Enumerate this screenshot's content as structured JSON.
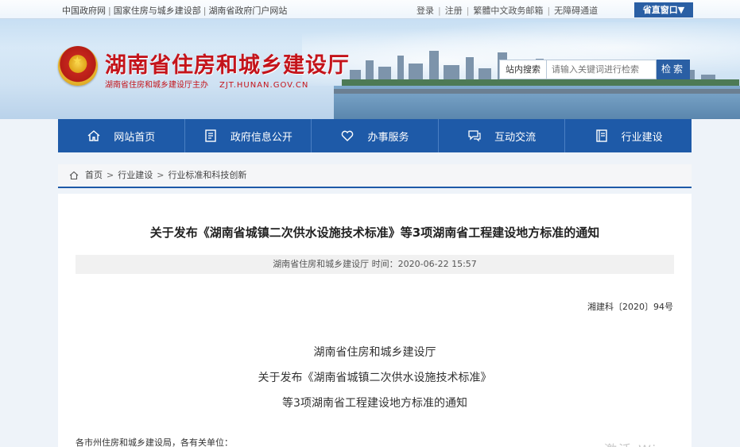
{
  "topbar": {
    "links": [
      "中国政府网",
      "国家住房与城乡建设部",
      "湖南省政府门户网站"
    ],
    "user_links": [
      "登录",
      "注册",
      "繁體中文",
      "政务邮箱",
      "无障碍通道"
    ],
    "window_button": "省直窗口▼"
  },
  "header": {
    "title": "湖南省住房和城乡建设厅",
    "sponsor": "湖南省住房和城乡建设厅主办",
    "domain": "ZJT.HUNAN.GOV.CN"
  },
  "search": {
    "label": "站内搜索",
    "placeholder": "请输入关键词进行检索",
    "button": "检索"
  },
  "nav": [
    {
      "label": "网站首页",
      "icon": "home-icon"
    },
    {
      "label": "政府信息公开",
      "icon": "document-icon"
    },
    {
      "label": "办事服务",
      "icon": "heart-icon"
    },
    {
      "label": "互动交流",
      "icon": "chat-icon"
    },
    {
      "label": "行业建设",
      "icon": "book-icon"
    }
  ],
  "breadcrumb": {
    "home": "首页",
    "level1": "行业建设",
    "level2": "行业标准和科技创新"
  },
  "article": {
    "title": "关于发布《湖南省城镇二次供水设施技术标准》等3项湖南省工程建设地方标准的通知",
    "meta": "湖南省住房和城乡建设厅 时间：2020-06-22 15:57",
    "doc_number": "湘建科〔2020〕94号",
    "issuer": "湖南省住房和城乡建设厅",
    "heading_line1": "关于发布《湖南省城镇二次供水设施技术标准》",
    "heading_line2": "等3项湖南省工程建设地方标准的通知",
    "salutation": "各市州住房和城乡建设局，各有关单位："
  },
  "watermark": "激活 Wi"
}
